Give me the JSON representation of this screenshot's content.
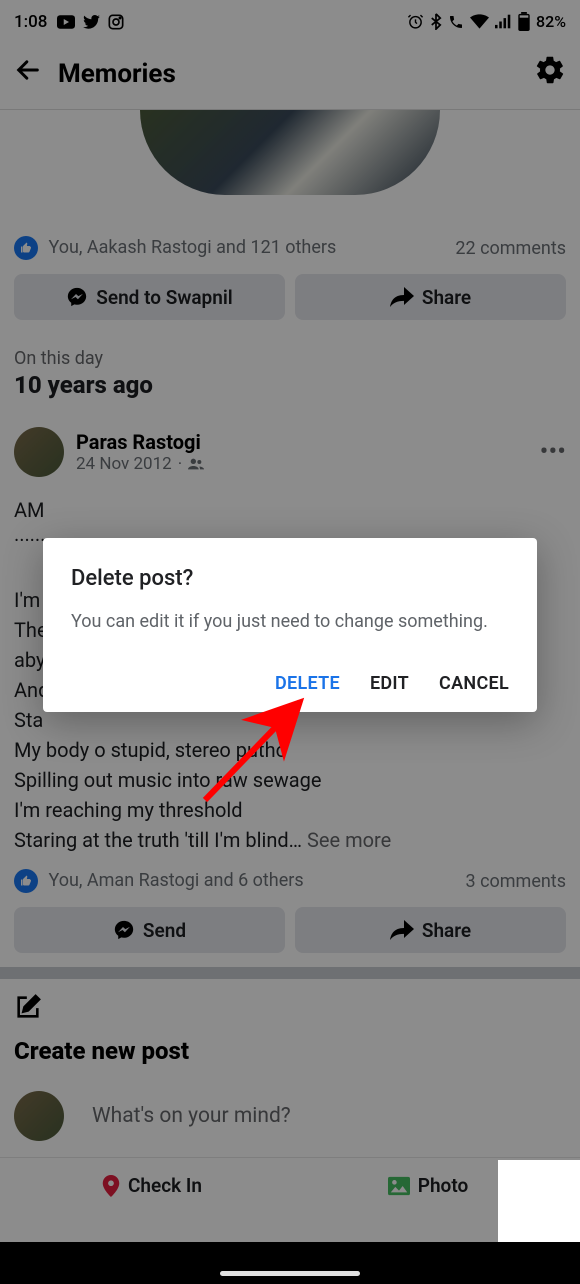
{
  "status": {
    "time": "1:08",
    "battery": "82%"
  },
  "header": {
    "title": "Memories"
  },
  "post1": {
    "reactions": "You, Aakash Rastogi and 121 others",
    "comments": "22 comments",
    "send_label": "Send to Swapnil",
    "share_label": "Share"
  },
  "post2": {
    "onthisday": "On this day",
    "yearsago": "10 years ago",
    "author": "Paras Rastogi",
    "date": "24 Nov 2012",
    "body_line1": "AM",
    "body_dots": "··········",
    "body_lines": "I'm\nThe\naby\nAnd\nSta\nMy body o stupid, stereo putho\nSpilling out music into raw sewage\nI'm reaching my threshold\nStaring at the truth 'till I'm blind…",
    "seemore": "See more",
    "reactions": "You, Aman Rastogi and 6 others",
    "comments": "3 comments",
    "send_label": "Send",
    "share_label": "Share"
  },
  "create": {
    "title": "Create new post",
    "prompt": "What's on your mind?",
    "checkin": "Check In",
    "photo": "Photo"
  },
  "dialog": {
    "title": "Delete post?",
    "message": "You can edit it if you just need to change something.",
    "delete": "DELETE",
    "edit": "EDIT",
    "cancel": "CANCEL"
  }
}
